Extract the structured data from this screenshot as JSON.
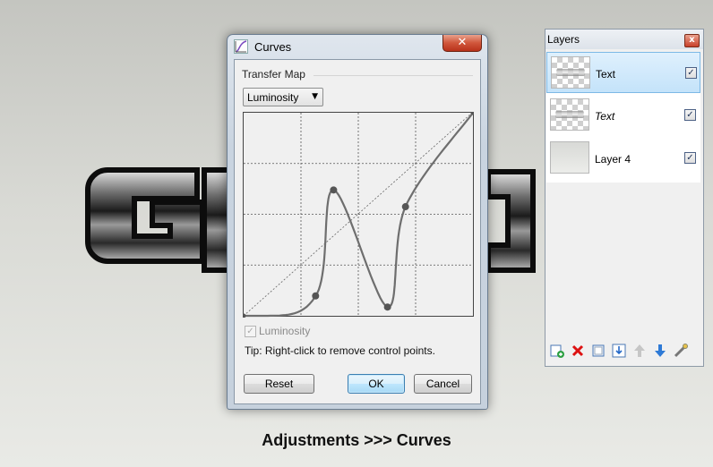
{
  "caption": "Adjustments >>> Curves",
  "background_art": {
    "visible_letters": "GL"
  },
  "curves_dialog": {
    "title": "Curves",
    "close_glyph": "✕",
    "group_label": "Transfer Map",
    "mode_select": {
      "selected": "Luminosity",
      "arrow": "▼"
    },
    "curve": {
      "control_points": [
        [
          0,
          0
        ],
        [
          80,
          25
        ],
        [
          100,
          158
        ],
        [
          160,
          11
        ],
        [
          180,
          137
        ],
        [
          255,
          255
        ]
      ]
    },
    "luminosity_checkbox": {
      "label": "Luminosity",
      "checked": true,
      "enabled": false,
      "check_glyph": "✓"
    },
    "tip": "Tip: Right-click to remove control points.",
    "buttons": {
      "reset": "Reset",
      "ok": "OK",
      "cancel": "Cancel"
    }
  },
  "layers_panel": {
    "title": "Layers",
    "close_glyph": "x",
    "layers": [
      {
        "name": "Text",
        "visible": true,
        "selected": true,
        "italic": false,
        "thumb": "checker"
      },
      {
        "name": "Text",
        "visible": true,
        "selected": false,
        "italic": true,
        "thumb": "checker"
      },
      {
        "name": "Layer 4",
        "visible": true,
        "selected": false,
        "italic": false,
        "thumb": "gray"
      }
    ],
    "check_glyph": "✓",
    "toolbar_icons": [
      "add-layer-icon",
      "delete-layer-icon",
      "duplicate-layer-icon",
      "merge-layer-down-icon",
      "move-layer-up-icon",
      "move-layer-down-icon",
      "layer-properties-icon"
    ]
  },
  "colors": {
    "selected_row": "#c4e3fa",
    "close_red": "#c8402a",
    "curve": "#707070"
  }
}
